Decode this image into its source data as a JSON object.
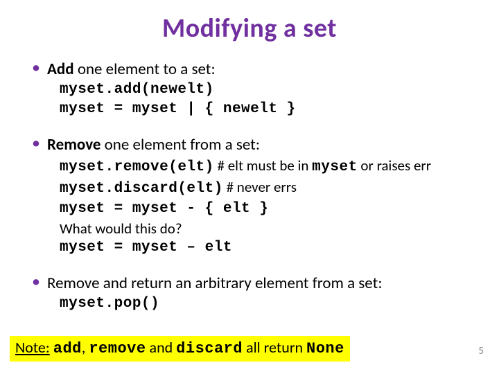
{
  "title": "Modifying a set",
  "bullets": [
    {
      "head_bold": "Add",
      "head_rest": " one element to a set:",
      "lines": [
        {
          "code": "myset.add(newelt)"
        },
        {
          "code": "myset = myset | { newelt }"
        }
      ]
    },
    {
      "head_bold": "Remove",
      "head_rest": " one element from a set:",
      "lines": [
        {
          "code": "myset.remove(elt)",
          "comment_prefix": "   # elt must be in ",
          "comment_code": "myset",
          "comment_suffix": " or raises err"
        },
        {
          "code": "myset.discard(elt)",
          "comment_prefix": " # never errs"
        },
        {
          "code": "myset = myset - { elt }"
        },
        {
          "text": "What would this do?"
        },
        {
          "code": "myset = myset – elt"
        }
      ]
    },
    {
      "head_bold": "",
      "head_rest": "Remove and return an arbitrary element from a set:",
      "lines": [
        {
          "code": "myset.pop()"
        }
      ]
    }
  ],
  "note": {
    "label": "Note:",
    "w1": "add",
    "sep1": ", ",
    "w2": "remove",
    "mid": " and ",
    "w3": "discard",
    "tail": " all return ",
    "w4": "None"
  },
  "page_number": "5"
}
